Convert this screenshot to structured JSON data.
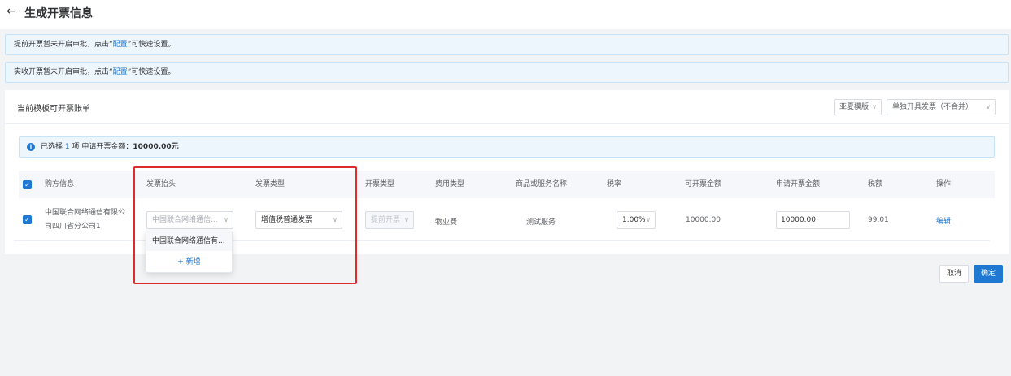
{
  "header": {
    "back_icon": "←",
    "title": "生成开票信息"
  },
  "notices": [
    {
      "prefix": "提前开票暂未开启审批，点击“",
      "link": "配置",
      "suffix": "”可快速设置。"
    },
    {
      "prefix": "实收开票暂未开启审批，点击“",
      "link": "配置",
      "suffix": "”可快速设置。"
    }
  ],
  "panel": {
    "title": "当前模板可开票账单",
    "template_select": "亚夏模版",
    "merge_select": "单独开具发票（不合并）"
  },
  "selection_bar": {
    "prefix": "已选择",
    "count": "1",
    "unit": "项",
    "amount_label": "申请开票金额：",
    "amount": "10000.00元"
  },
  "table": {
    "headers": [
      "购方信息",
      "发票抬头",
      "发票类型",
      "开票类型",
      "费用类型",
      "商品或服务名称",
      "税率",
      "可开票金额",
      "申请开票金额",
      "税额",
      "操作"
    ],
    "row": {
      "buyer_line1": "中国联合网络通信有限公",
      "buyer_line2": "司四川省分公司1",
      "invoice_header": "中国联合网络通信...",
      "invoice_type": "增值税普通发票",
      "billing_type": "提前开票",
      "fee_type": "物业费",
      "service_name": "测试服务",
      "tax_rate": "1.00%",
      "billable_amount": "10000.00",
      "apply_amount": "10000.00",
      "tax_amount": "99.01",
      "action": "编辑"
    }
  },
  "dropdown": {
    "option": "中国联合网络通信有...",
    "add_label": "新增",
    "add_icon": "+"
  },
  "footer": {
    "cancel": "取消",
    "confirm": "确定"
  },
  "colors": {
    "primary": "#1f78d1",
    "highlight": "#e02b2b"
  }
}
